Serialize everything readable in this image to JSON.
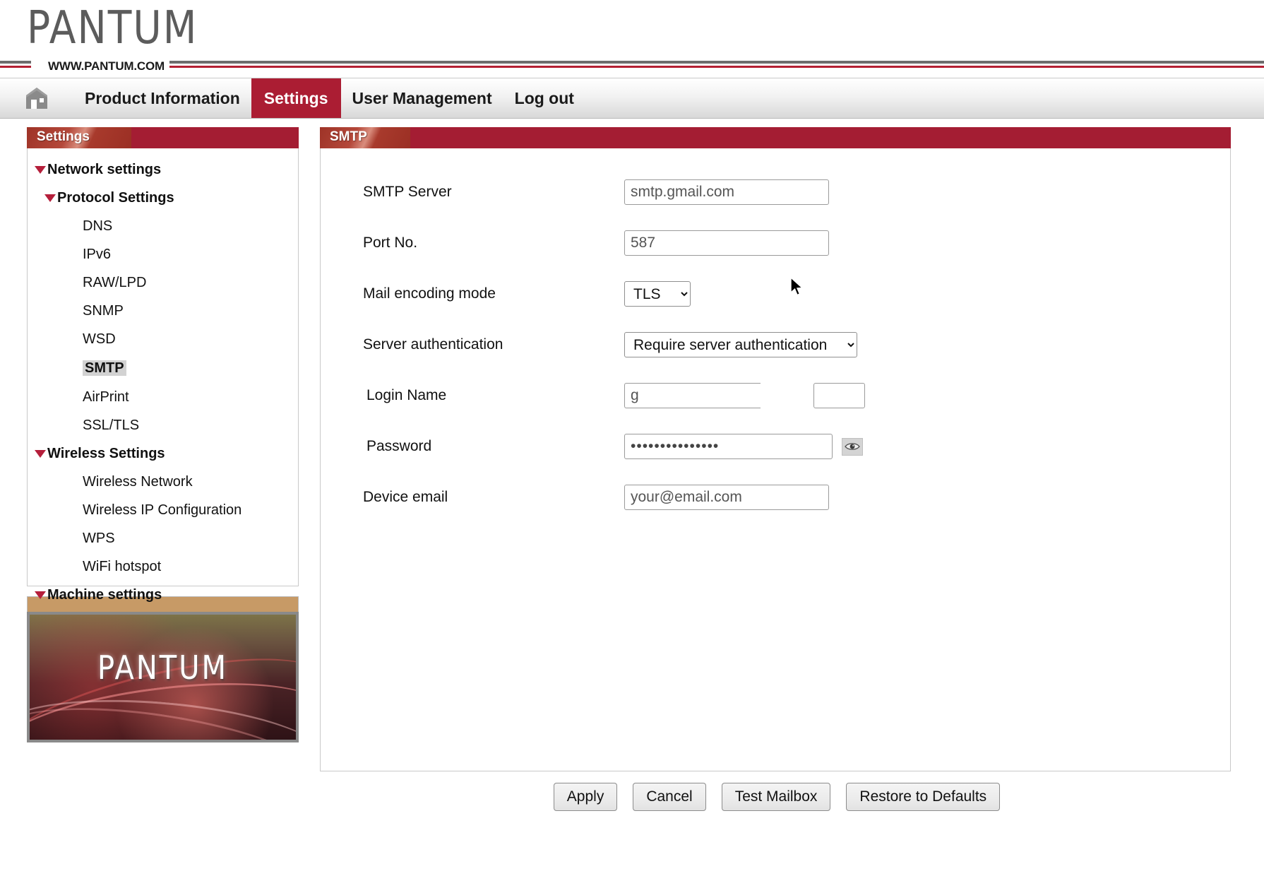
{
  "brand": {
    "logo_text": "PANTUM",
    "url_text": "WWW.PANTUM.COM"
  },
  "nav": {
    "home_icon": "home-icon",
    "items": [
      {
        "label": "Product Information",
        "active": false
      },
      {
        "label": "Settings",
        "active": true
      },
      {
        "label": "User Management",
        "active": false
      },
      {
        "label": "Log out",
        "active": false
      }
    ]
  },
  "sidebar": {
    "title": "Settings",
    "items": [
      {
        "label": "Network settings",
        "level": 0,
        "caret": true,
        "selected": false
      },
      {
        "label": "Protocol Settings",
        "level": 1,
        "caret": true,
        "selected": false
      },
      {
        "label": "DNS",
        "level": 2,
        "caret": false,
        "selected": false
      },
      {
        "label": "IPv6",
        "level": 2,
        "caret": false,
        "selected": false
      },
      {
        "label": "RAW/LPD",
        "level": 2,
        "caret": false,
        "selected": false
      },
      {
        "label": "SNMP",
        "level": 2,
        "caret": false,
        "selected": false
      },
      {
        "label": "WSD",
        "level": 2,
        "caret": false,
        "selected": false
      },
      {
        "label": "SMTP",
        "level": 2,
        "caret": false,
        "selected": true
      },
      {
        "label": "AirPrint",
        "level": 2,
        "caret": false,
        "selected": false
      },
      {
        "label": "SSL/TLS",
        "level": 2,
        "caret": false,
        "selected": false
      },
      {
        "label": "Wireless Settings",
        "level": 0,
        "caret": true,
        "selected": false
      },
      {
        "label": "Wireless Network",
        "level": 2,
        "caret": false,
        "selected": false
      },
      {
        "label": "Wireless IP Configuration",
        "level": 2,
        "caret": false,
        "selected": false
      },
      {
        "label": "WPS",
        "level": 2,
        "caret": false,
        "selected": false
      },
      {
        "label": "WiFi hotspot",
        "level": 2,
        "caret": false,
        "selected": false
      },
      {
        "label": "Machine settings",
        "level": 0,
        "caret": true,
        "selected": false
      }
    ],
    "banner_text": "PANTUM"
  },
  "main": {
    "title": "SMTP",
    "fields": {
      "smtp_server": {
        "label": "SMTP Server",
        "value": "smtp.gmail.com",
        "placeholder": "smtp.gmail.com"
      },
      "port_no": {
        "label": "Port No.",
        "value": "587",
        "placeholder": "587"
      },
      "mail_encoding_mode": {
        "label": "Mail encoding mode",
        "value": "TLS",
        "options": [
          "TLS"
        ]
      },
      "server_authentication": {
        "label": "Server authentication",
        "value": "Require server authentication",
        "options": [
          "Require server authentication"
        ]
      },
      "login_name": {
        "label": "Login Name",
        "value": "g",
        "placeholder": ""
      },
      "password": {
        "label": "Password",
        "value": "•••••••••••••••",
        "toggle_icon": "eye-icon"
      },
      "device_email": {
        "label": "Device email",
        "value": "your@email.com",
        "placeholder": "your@email.com"
      }
    }
  },
  "footer": {
    "buttons": [
      {
        "label": "Apply"
      },
      {
        "label": "Cancel"
      },
      {
        "label": "Test Mailbox"
      },
      {
        "label": "Restore to Defaults"
      }
    ]
  },
  "colors": {
    "brand_red": "#ab1d33",
    "panel_red": "#a41d33",
    "tab_orange": "#b4483a",
    "caret_red": "#b51f3b",
    "banner_strip": "#c79a66",
    "selected_bg": "#d2d2d2"
  }
}
